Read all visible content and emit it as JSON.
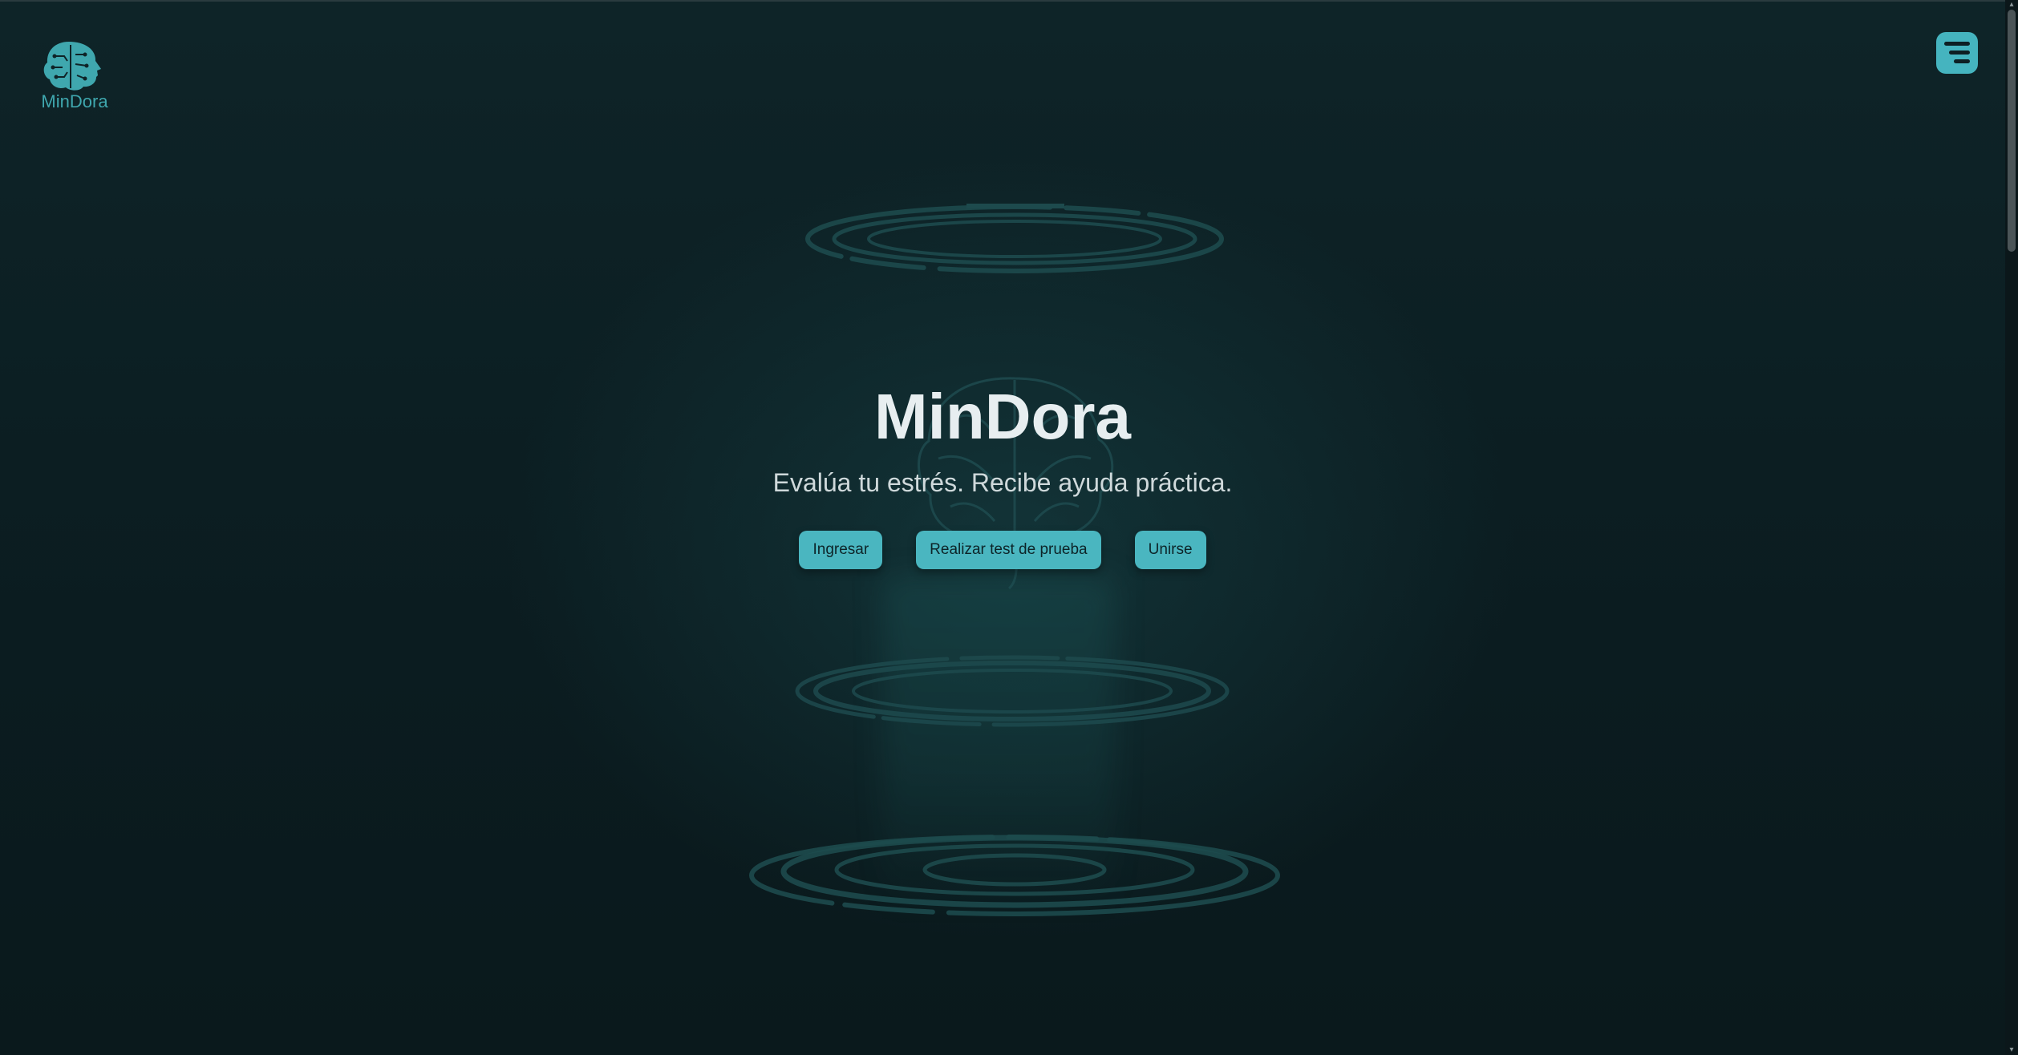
{
  "brand": {
    "logo_text": "MinDora",
    "logo_icon": "brain-head-icon",
    "accent_color": "#45b4bf"
  },
  "header": {
    "menu_icon": "menu-icon"
  },
  "hero": {
    "title": "MinDora",
    "subtitle": "Evalúa tu estrés. Recibe ayuda práctica.",
    "actions": {
      "login_label": "Ingresar",
      "test_label": "Realizar test de prueba",
      "join_label": "Unirse"
    }
  }
}
